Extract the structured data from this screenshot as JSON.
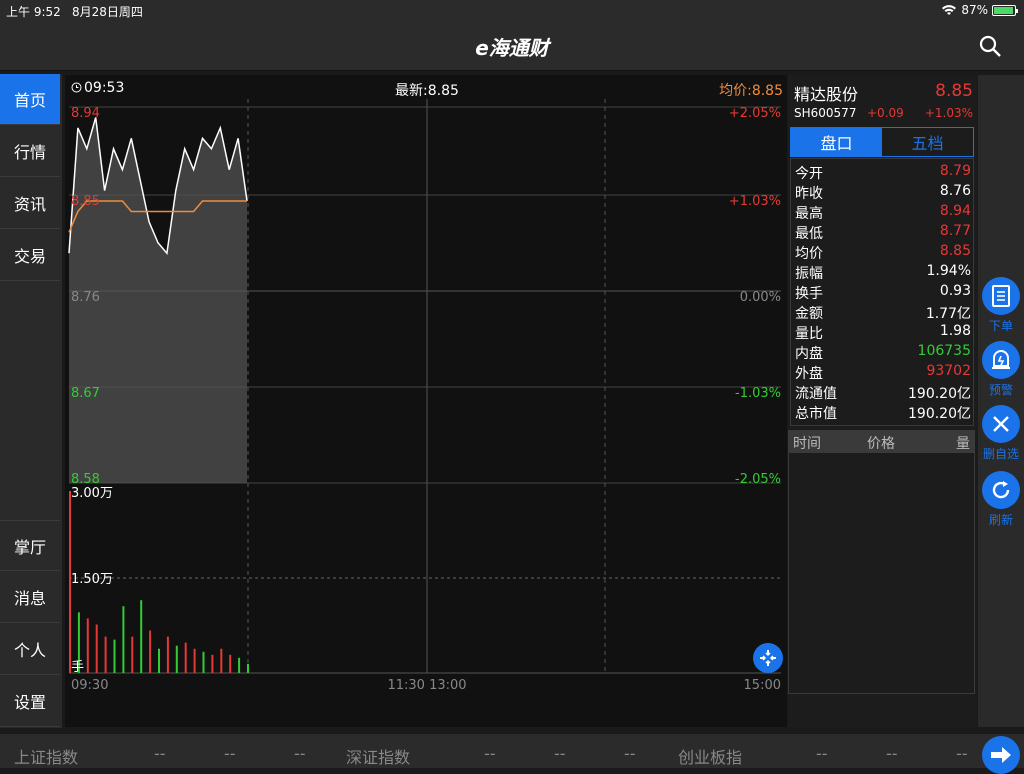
{
  "status": {
    "time": "上午 9:52",
    "date": "8月28日周四",
    "battery": "87%",
    "battery_level": 0.87
  },
  "header": {
    "logo": "e海通财"
  },
  "sidebar": {
    "top_items": [
      {
        "label": "首页",
        "active": true
      },
      {
        "label": "行情"
      },
      {
        "label": "资讯"
      },
      {
        "label": "交易"
      }
    ],
    "bottom_items": [
      {
        "label": "掌厅"
      },
      {
        "label": "消息"
      },
      {
        "label": "个人"
      },
      {
        "label": "设置"
      }
    ]
  },
  "chart_header": {
    "time": "09:53",
    "latest": "最新:8.85",
    "avg": "均价:8.85"
  },
  "chart_data": {
    "type": "line",
    "price_axis": {
      "labels": [
        "8.94",
        "8.85",
        "8.76",
        "8.67",
        "8.58"
      ],
      "ylim": [
        8.58,
        8.94
      ]
    },
    "pct_axis": {
      "labels": [
        "+2.05%",
        "+1.03%",
        "0.00%",
        "-1.03%",
        "-2.05%"
      ]
    },
    "x_labels": [
      "09:30",
      "11:30 13:00",
      "15:00"
    ],
    "volume_axis": {
      "labels": [
        "3.00万",
        "1.50万",
        "手"
      ],
      "ylim": [
        0,
        30000
      ]
    },
    "series": [
      {
        "role": "price",
        "color": "#ffffff",
        "values": [
          8.8,
          8.92,
          8.9,
          8.93,
          8.86,
          8.9,
          8.88,
          8.91,
          8.87,
          8.83,
          8.81,
          8.8,
          8.86,
          8.9,
          8.88,
          8.91,
          8.9,
          8.92,
          8.88,
          8.91,
          8.85
        ]
      },
      {
        "role": "avg",
        "color": "#f08c3c",
        "values": [
          8.82,
          8.84,
          8.85,
          8.85,
          8.85,
          8.85,
          8.85,
          8.84,
          8.84,
          8.84,
          8.84,
          8.84,
          8.84,
          8.84,
          8.84,
          8.85,
          8.85,
          8.85,
          8.85,
          8.85,
          8.85
        ]
      }
    ],
    "volume": [
      {
        "v": 30000,
        "c": "red"
      },
      {
        "v": 10000,
        "c": "green"
      },
      {
        "v": 9000,
        "c": "red"
      },
      {
        "v": 8000,
        "c": "red"
      },
      {
        "v": 6000,
        "c": "red"
      },
      {
        "v": 5500,
        "c": "green"
      },
      {
        "v": 11000,
        "c": "green"
      },
      {
        "v": 6000,
        "c": "red"
      },
      {
        "v": 12000,
        "c": "green"
      },
      {
        "v": 7000,
        "c": "red"
      },
      {
        "v": 4000,
        "c": "green"
      },
      {
        "v": 6000,
        "c": "red"
      },
      {
        "v": 4500,
        "c": "green"
      },
      {
        "v": 5000,
        "c": "red"
      },
      {
        "v": 4000,
        "c": "red"
      },
      {
        "v": 3500,
        "c": "green"
      },
      {
        "v": 3000,
        "c": "red"
      },
      {
        "v": 4000,
        "c": "red"
      },
      {
        "v": 3000,
        "c": "red"
      },
      {
        "v": 2500,
        "c": "green"
      },
      {
        "v": 1500,
        "c": "green"
      }
    ]
  },
  "stock": {
    "name": "精达股份",
    "price": "8.85",
    "code": "SH600577",
    "change": "+0.09",
    "pct": "+1.03%"
  },
  "tabs": [
    {
      "label": "盘口",
      "active": true
    },
    {
      "label": "五档"
    }
  ],
  "stats": [
    {
      "label": "今开",
      "value": "8.79",
      "color": "#e53935"
    },
    {
      "label": "昨收",
      "value": "8.76",
      "color": "#ffffff"
    },
    {
      "label": "最高",
      "value": "8.94",
      "color": "#e53935"
    },
    {
      "label": "最低",
      "value": "8.77",
      "color": "#e53935"
    },
    {
      "label": "均价",
      "value": "8.85",
      "color": "#e53935"
    },
    {
      "label": "振幅",
      "value": "1.94%",
      "color": "#ffffff"
    },
    {
      "label": "换手",
      "value": "0.93",
      "color": "#ffffff"
    },
    {
      "label": "金额",
      "value": "1.77亿",
      "color": "#ffffff"
    },
    {
      "label": "量比",
      "value": "1.98",
      "color": "#ffffff"
    },
    {
      "label": "内盘",
      "value": "106735",
      "color": "#33cc33"
    },
    {
      "label": "外盘",
      "value": "93702",
      "color": "#e53935"
    },
    {
      "label": "流通值",
      "value": "190.20亿",
      "color": "#ffffff"
    },
    {
      "label": "总市值",
      "value": "190.20亿",
      "color": "#ffffff"
    }
  ],
  "trade_table": {
    "headers": [
      "时间",
      "价格",
      "量"
    ]
  },
  "right_actions": [
    {
      "label": "下单",
      "icon": "order-icon"
    },
    {
      "label": "预警",
      "icon": "alarm-icon"
    },
    {
      "label": "删自选",
      "icon": "close-icon"
    },
    {
      "label": "刷新",
      "icon": "refresh-icon"
    }
  ],
  "bottom_indices": [
    {
      "name": "上证指数",
      "v1": "--",
      "v2": "--",
      "v3": "--"
    },
    {
      "name": "深证指数",
      "v1": "--",
      "v2": "--",
      "v3": "--"
    },
    {
      "name": "创业板指",
      "v1": "--",
      "v2": "--",
      "v3": "--"
    }
  ]
}
